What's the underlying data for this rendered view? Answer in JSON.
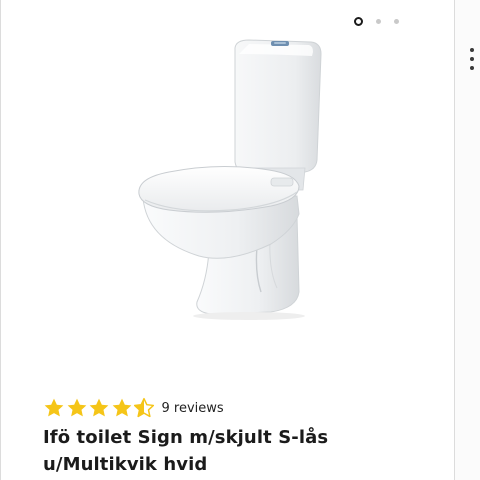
{
  "gallery": {
    "image_count": 3,
    "active_index": 0,
    "image_alt_icon": "toilet-product-image"
  },
  "rating": {
    "stars": 4.5,
    "max_stars": 5,
    "star_color": "#f5c518",
    "reviews_label": "9 reviews"
  },
  "product": {
    "title": "Ifö toilet Sign m/skjult S-lås u/Multikvik hvid"
  },
  "colors": {
    "text": "#1b1b1b",
    "dot_inactive": "#c9c9c9"
  }
}
